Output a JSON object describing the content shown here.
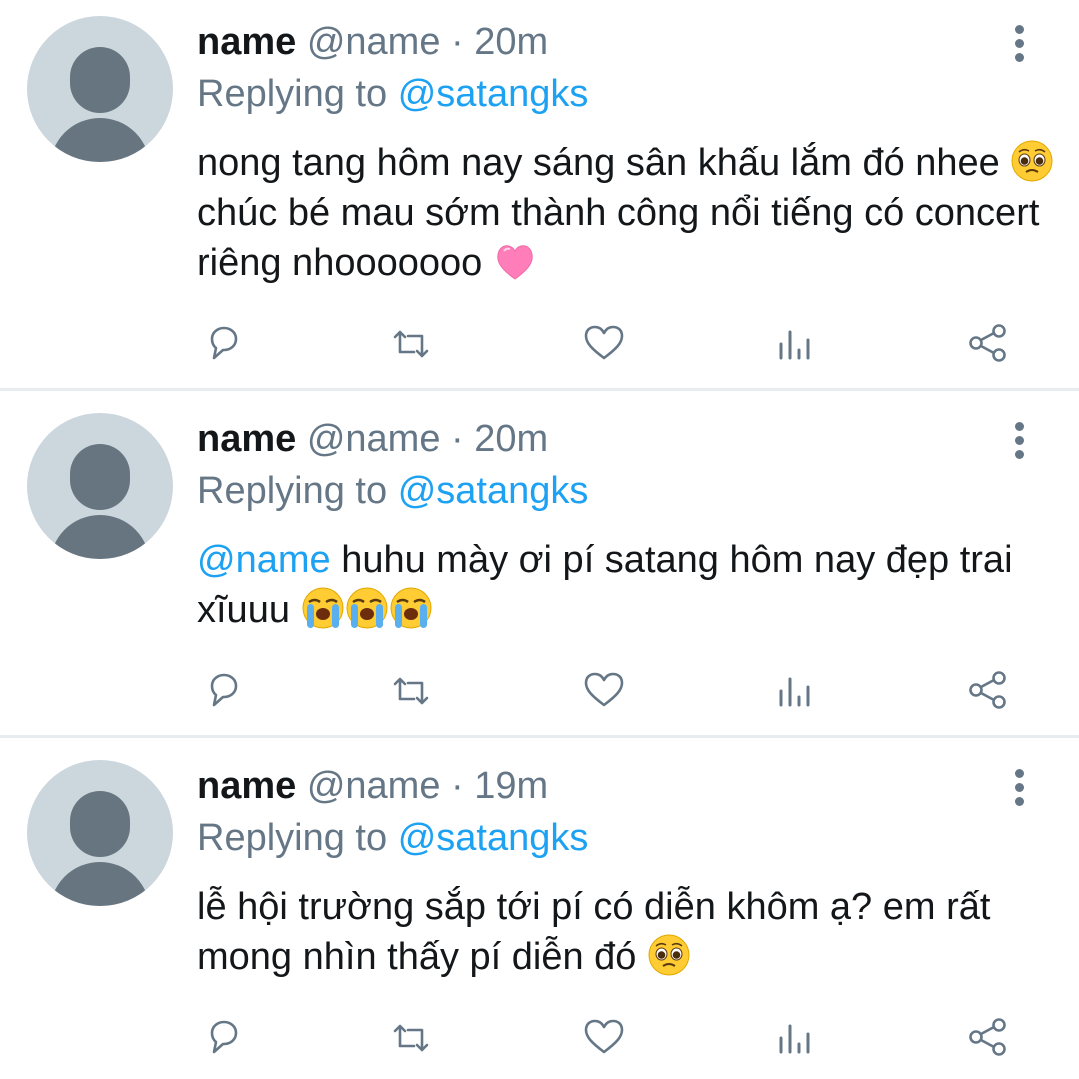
{
  "tweets": [
    {
      "display_name": "name",
      "handle": "@name",
      "separator": "·",
      "time": "20m",
      "replying_prefix": "Replying to",
      "replying_to": "@satangks",
      "text_segments": [
        "nong tang hôm nay sáng sân khấu lắm đó nhee ",
        " chúc bé mau sớm thành công nổi tiếng có concert riêng nhooooooo "
      ],
      "emojis": [
        "pleading-face",
        "pink-heart"
      ]
    },
    {
      "display_name": "name",
      "handle": "@name",
      "separator": "·",
      "time": "20m",
      "replying_prefix": "Replying to",
      "replying_to": "@satangks",
      "mention": "@name",
      "text": " huhu mày ơi pí satang hôm nay đẹp trai xĩuuu ",
      "emojis": [
        "crying-face",
        "crying-face",
        "crying-face"
      ]
    },
    {
      "display_name": "name",
      "handle": "@name",
      "separator": "·",
      "time": "19m",
      "replying_prefix": "Replying to",
      "replying_to": "@satangks",
      "text": "lễ hội trường sắp tới pí có diễn khôm ạ? em rất mong nhìn thấy pí diễn đó ",
      "emojis": [
        "pleading-face"
      ]
    }
  ],
  "actions": [
    "reply-icon",
    "retweet-icon",
    "like-icon",
    "analytics-icon",
    "share-icon"
  ],
  "colors": {
    "text": "#14171a",
    "muted": "#657786",
    "accent": "#1da1f2",
    "divider": "#e6ecf0",
    "avatar_bg": "#ccd6dd"
  }
}
